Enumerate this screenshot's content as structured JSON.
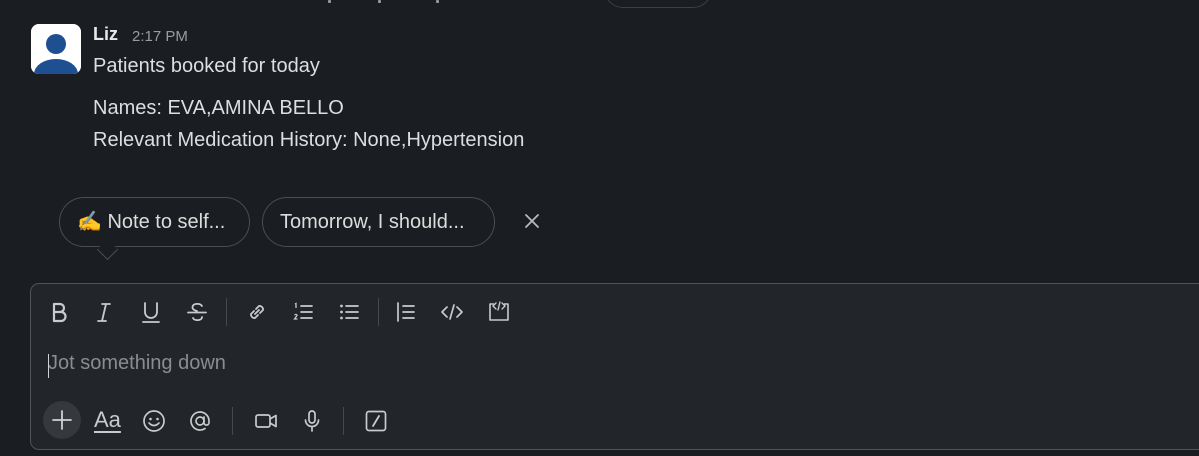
{
  "message": {
    "sender": "Liz",
    "time": "2:17 PM",
    "lines": [
      "Patients booked for today",
      "Names: EVA,AMINA BELLO",
      "Relevant Medication History: None,Hypertension"
    ]
  },
  "suggestions": {
    "chips": [
      {
        "label": "✍️ Note to self..."
      },
      {
        "label": "Tomorrow, I should..."
      }
    ]
  },
  "composer": {
    "placeholder": "Jot something down",
    "format_label": "Aa"
  },
  "colors": {
    "background": "#1a1d21",
    "composer_bg": "#222529",
    "text": "#d1d2d3",
    "muted": "#9a9b9d"
  }
}
